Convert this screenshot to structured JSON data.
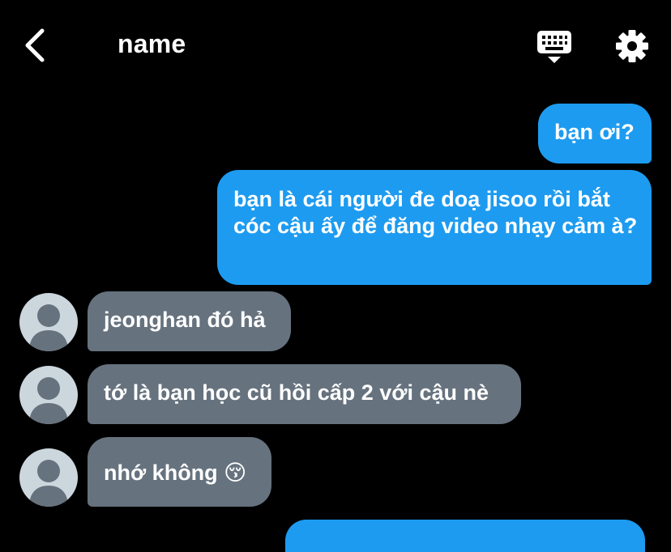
{
  "header": {
    "title": "name",
    "back_icon": "chevron-left-icon",
    "keyboard_icon": "keyboard-icon",
    "settings_icon": "gear-icon"
  },
  "colors": {
    "background": "#000000",
    "outgoing_bubble": "#1d9bf0",
    "incoming_bubble": "#66727e",
    "avatar_bg": "#ccd6dd",
    "avatar_fg": "#66727e"
  },
  "messages": [
    {
      "direction": "outgoing",
      "text": "bạn ơi?"
    },
    {
      "direction": "outgoing",
      "text": "bạn là cái người đe doạ jisoo rồi bắt cóc cậu ấy để đăng video nhạy cảm à?"
    },
    {
      "direction": "incoming",
      "text": "jeonghan đó hả"
    },
    {
      "direction": "incoming",
      "text": "tớ là bạn học cũ hồi cấp 2 với cậu nè"
    },
    {
      "direction": "incoming",
      "text": "nhớ không 😚"
    }
  ]
}
